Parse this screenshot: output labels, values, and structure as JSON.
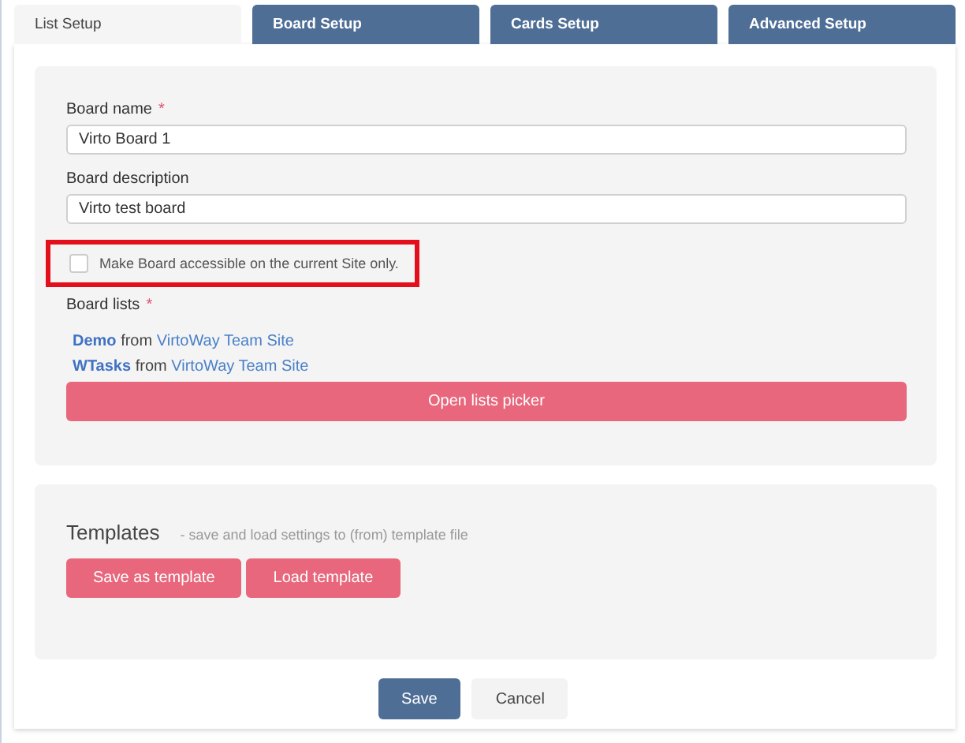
{
  "tabs": [
    {
      "label": "List Setup",
      "selected": true
    },
    {
      "label": "Board Setup",
      "selected": false
    },
    {
      "label": "Cards Setup",
      "selected": false
    },
    {
      "label": "Advanced Setup",
      "selected": false
    }
  ],
  "fields": [
    {
      "label": "Board name",
      "required_mark": "*",
      "value": "Virto Board 1"
    },
    {
      "label": "Board description",
      "value": "Virto test board"
    }
  ],
  "checkbox": {
    "label": "Make Board accessible on the current Site only.",
    "checked": false,
    "highlighted": true
  },
  "board_lists": {
    "label": "Board lists",
    "required_mark": "*",
    "items": [
      {
        "name": "Demo",
        "joiner": "from",
        "site": "VirtoWay Team Site"
      },
      {
        "name": "WTasks",
        "joiner": "from",
        "site": "VirtoWay Team Site"
      }
    ],
    "button": "Open lists picker"
  },
  "templates": {
    "title": "Templates",
    "hint": "- save and load settings to (from) template file",
    "buttons": [
      "Save as template",
      "Load template"
    ]
  },
  "footer_buttons": [
    {
      "label": "Save",
      "kind": "primary"
    },
    {
      "label": "Cancel",
      "kind": "secondary"
    }
  ]
}
